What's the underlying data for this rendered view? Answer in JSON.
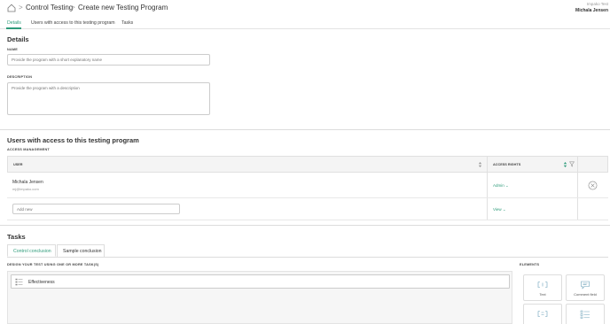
{
  "breadcrumb": {
    "items": [
      "Control Testing",
      "Create new Testing Program"
    ],
    "separator": ">"
  },
  "user": {
    "org": "Impako Test",
    "name": "Michala Jensen"
  },
  "tabs": [
    "Details",
    "Users with access to this testing program",
    "Tasks"
  ],
  "details": {
    "title": "Details",
    "name_label": "NAME",
    "name_placeholder": "Provide the program with a short explanatory name",
    "description_label": "DESCRIPTION",
    "description_placeholder": "Provide the program with a description"
  },
  "access": {
    "title": "Users with access to this testing program",
    "subtitle": "ACCESS MANAGEMENT",
    "col_user": "USER",
    "col_rights": "ACCESS RIGHTS",
    "rows": [
      {
        "name": "Michala Jensen",
        "email": "mj@impako.com",
        "rights": "Admin ⌄"
      }
    ],
    "add_placeholder": "Add new",
    "add_rights": "View ⌄"
  },
  "tasks": {
    "title": "Tasks",
    "tabs": [
      "Control conclusion",
      "Sample conclusion"
    ],
    "design_label": "DESIGN YOUR TEST USING ONE OR MORE TASK(S)",
    "items": [
      "Effectiveness"
    ],
    "elements_label": "ELEMENTS",
    "elements": [
      "Text",
      "Comment field"
    ]
  },
  "colors": {
    "accent": "#2e9b7a"
  }
}
